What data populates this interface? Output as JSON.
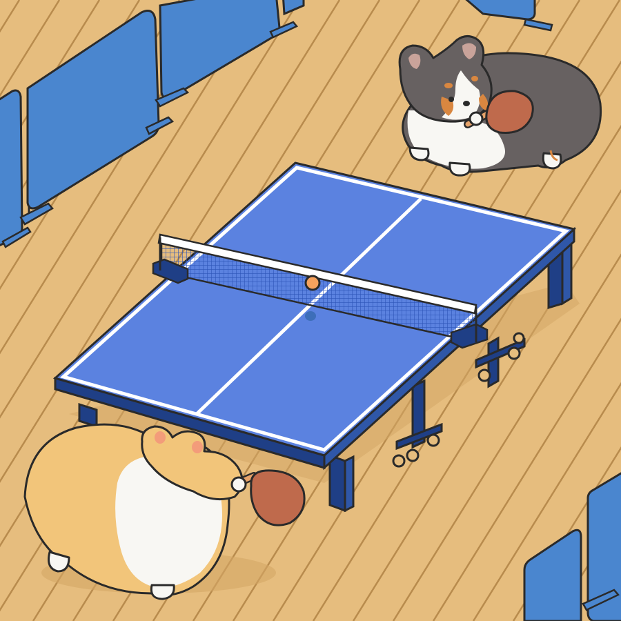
{
  "scene": {
    "subject": "table-tennis-corgis",
    "colors": {
      "floor": "#e6bd7e",
      "floor_line": "#b88b4d",
      "table_top": "#5b82e0",
      "table_frame": "#1f3f86",
      "table_line": "#ffffff",
      "net_mesh": "#2d55b8",
      "divider": "#4a86cf",
      "divider_dark": "#2f5f9f",
      "paddle": "#bf6a4c",
      "paddle_handle": "#e6a36a",
      "ball": "#f6a25d",
      "corgi_tan": "#f2c57a",
      "corgi_black": "#676161",
      "corgi_white": "#f8f7f3",
      "outline": "#2a2a2a"
    },
    "figures": [
      {
        "name": "tan-corgi",
        "color": "tan-and-white",
        "holds": "paddle"
      },
      {
        "name": "tricolor-corgi",
        "color": "black-tricolor",
        "holds": "paddle"
      }
    ],
    "ball_in_play": true
  }
}
